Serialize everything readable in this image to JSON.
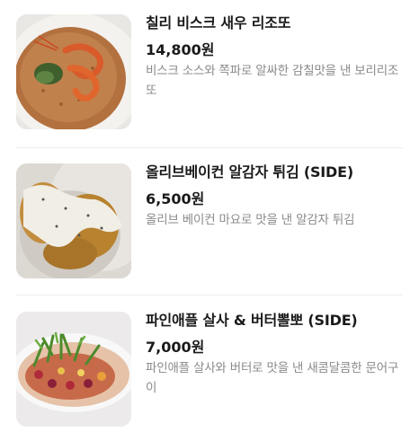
{
  "menu": {
    "items": [
      {
        "name": "칠리 비스크 새우 리조또",
        "price": "14,800원",
        "description": "비스크 소스와 쪽파로 알싸한 감칠맛을 낸 보리리조또",
        "image_icon": "shrimp-risotto-photo"
      },
      {
        "name": "올리브베이컨 알감자 튀김 (SIDE)",
        "price": "6,500원",
        "description": "올리브 베이컨 마요로 맛을 낸 알감자 튀김",
        "image_icon": "fried-potato-photo"
      },
      {
        "name": "파인애플 살사 & 버터뽈뽀 (SIDE)",
        "price": "7,000원",
        "description": "파인애플 살사와 버터로 맛을 낸 새콤달콤한 문어구이",
        "image_icon": "octopus-salsa-photo"
      }
    ]
  }
}
